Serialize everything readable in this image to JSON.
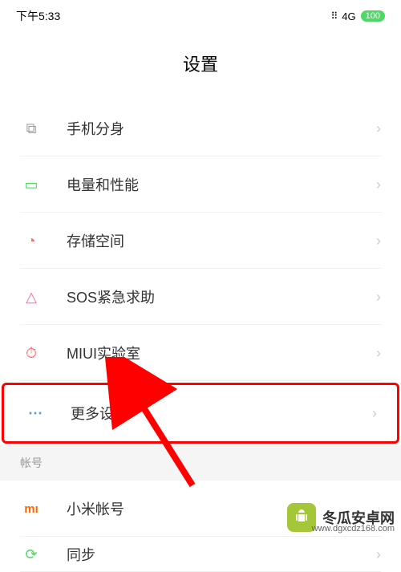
{
  "status": {
    "time": "下午5:33",
    "signal": "⠿",
    "network": "4G",
    "battery": "100"
  },
  "page": {
    "title": "设置"
  },
  "items": [
    {
      "icon": "⧉",
      "iconColor": "#999",
      "label": "手机分身"
    },
    {
      "icon": "▭",
      "iconColor": "#4cd964",
      "label": "电量和性能"
    },
    {
      "icon": "◔",
      "iconColor": "#ff6b6b",
      "label": "存储空间"
    },
    {
      "icon": "△",
      "iconColor": "#ff6b9d",
      "label": "SOS紧急求助"
    },
    {
      "icon": "⏱",
      "iconColor": "#ff6b6b",
      "label": "MIUI实验室"
    },
    {
      "icon": "⋯",
      "iconColor": "#5b9bd5",
      "label": "更多设置",
      "highlight": true
    }
  ],
  "section": {
    "header": "帐号"
  },
  "accountItems": [
    {
      "icon": "mı",
      "iconColor": "#ff6700",
      "label": "小米帐号",
      "value": "··· ···"
    },
    {
      "icon": "⟳",
      "iconColor": "#4cd964",
      "label": "同步"
    }
  ],
  "watermark": {
    "text": "冬瓜安卓网",
    "url": "www.dgxcdz168.com"
  }
}
